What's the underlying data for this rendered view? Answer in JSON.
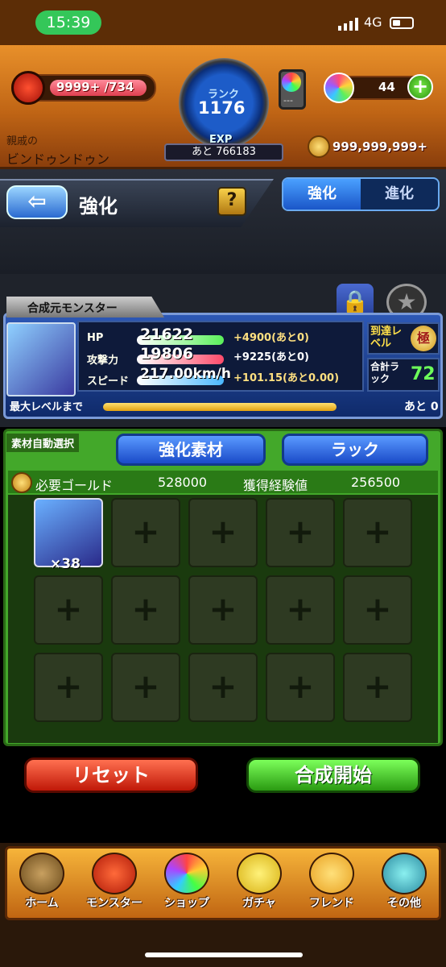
{
  "status": {
    "time": "15:39",
    "network": "4G"
  },
  "header": {
    "stamina": "9999+ /734",
    "rank_label": "ランク",
    "rank": "1176",
    "exp_label": "EXP",
    "exp_remaining": "あと 766183",
    "relation_label": "親戚の",
    "player_name": "ビンドゥンドゥン",
    "gem_box_label": "---",
    "orb_count": "44",
    "gold": "999,999,999+"
  },
  "subheader": {
    "title": "強化",
    "help": "?",
    "tab_enhance": "強化",
    "tab_evolve": "進化"
  },
  "card": {
    "label": "合成元モンスター",
    "hp_label": "HP",
    "hp": "21622",
    "hp_add": "+4900(あと0)",
    "atk_label": "攻撃力",
    "atk": "19806",
    "atk_add": "+9225(あと0)",
    "spd_label": "スピード",
    "spd": "217.00km/h",
    "spd_add": "+101.15(あと0.00)",
    "reach_label": "到達レベル",
    "reach_badge": "極",
    "luck_label": "合計ラック",
    "luck": "72",
    "max_label": "最大レベルまで",
    "max_rest": "あと 0"
  },
  "materials": {
    "auto_label": "素材自動選択",
    "btn_enhance": "強化素材",
    "btn_luck": "ラック",
    "gold_label": "必要ゴールド",
    "gold_value": "528000",
    "exp_label": "獲得経験値",
    "exp_value": "256500",
    "first_count": "×38",
    "empty_slot": "+"
  },
  "buttons": {
    "reset": "リセット",
    "fuse": "合成開始"
  },
  "nav": [
    "ホーム",
    "モンスター",
    "ショップ",
    "ガチャ",
    "フレンド",
    "その他"
  ]
}
